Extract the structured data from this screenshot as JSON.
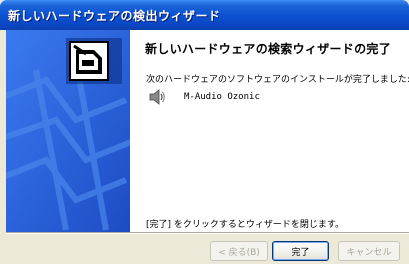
{
  "window": {
    "title": "新しいハードウェアの検出ウィザード"
  },
  "content": {
    "heading": "新しいハードウェアの検索ウィザードの完了",
    "message": "次のハードウェアのソフトウェアのインストールが完了しました:",
    "device_icon": "speaker-icon",
    "device_name": "M-Audio Ozonic",
    "footer": "[完了] をクリックするとウィザードを閉じます。"
  },
  "buttons": {
    "back": "< 戻る(B)",
    "finish": "完了",
    "cancel": "キャンセル"
  },
  "colors": {
    "titlebar": "#0a50d0",
    "left_panel": "#1f4fc9",
    "dialog_bg": "#ece9d8"
  }
}
